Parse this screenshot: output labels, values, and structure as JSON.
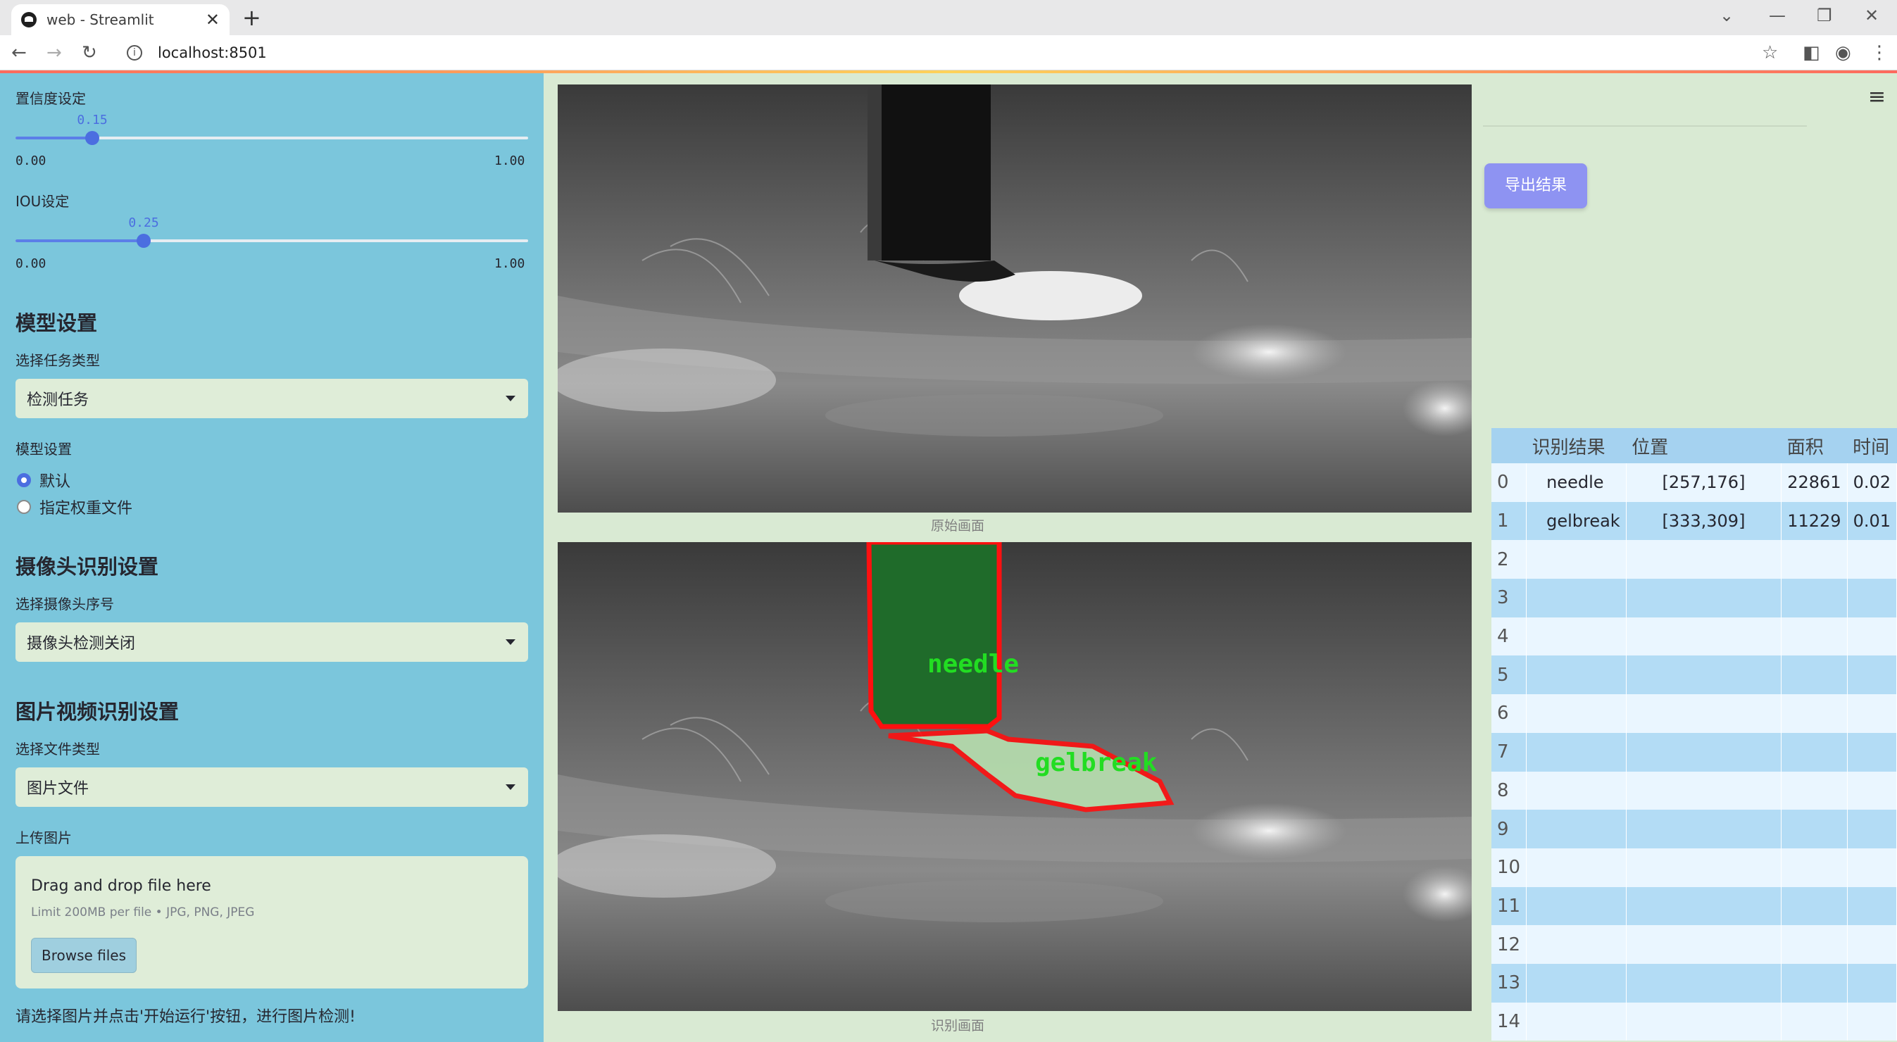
{
  "browser": {
    "tab_title": "web - Streamlit",
    "new_tab": "+",
    "url": "localhost:8501"
  },
  "sidebar": {
    "confidence": {
      "label": "置信度设定",
      "value": "0.15",
      "min": "0.00",
      "max": "1.00",
      "fraction": 0.15
    },
    "iou": {
      "label": "IOU设定",
      "value": "0.25",
      "min": "0.00",
      "max": "1.00",
      "fraction": 0.25
    },
    "model_section": {
      "heading": "模型设置",
      "task_label": "选择任务类型",
      "task_value": "检测任务",
      "model_label": "模型设置",
      "options": [
        "默认",
        "指定权重文件"
      ],
      "selected": "默认"
    },
    "camera_section": {
      "heading": "摄像头识别设置",
      "camera_label": "选择摄像头序号",
      "camera_value": "摄像头检测关闭"
    },
    "media_section": {
      "heading": "图片视频识别设置",
      "file_type_label": "选择文件类型",
      "file_type_value": "图片文件",
      "upload_label": "上传图片",
      "drop_text": "Drag and drop file here",
      "limit_text": "Limit 200MB per file • JPG, PNG, JPEG",
      "browse_label": "Browse files"
    },
    "footer_text": "请选择图片并点击'开始运行'按钮，进行图片检测!"
  },
  "main": {
    "original_caption": "原始画面",
    "detected_caption": "识别画面",
    "export_label": "导出结果",
    "detection_labels": [
      "needle",
      "gelbreak"
    ],
    "colors": {
      "mask_outline": "#ff0000",
      "label_text": "#22dd22"
    }
  },
  "results_table": {
    "headers": [
      "识别结果",
      "位置",
      "面积",
      "时间"
    ],
    "rows": [
      {
        "idx": "0",
        "name": "needle",
        "pos": "[257,176]",
        "area": "22861",
        "time": "0.02"
      },
      {
        "idx": "1",
        "name": "gelbreak",
        "pos": "[333,309]",
        "area": "11229",
        "time": "0.01"
      },
      {
        "idx": "2"
      },
      {
        "idx": "3"
      },
      {
        "idx": "4"
      },
      {
        "idx": "5"
      },
      {
        "idx": "6"
      },
      {
        "idx": "7"
      },
      {
        "idx": "8"
      },
      {
        "idx": "9"
      },
      {
        "idx": "10"
      },
      {
        "idx": "11"
      },
      {
        "idx": "12"
      },
      {
        "idx": "13"
      },
      {
        "idx": "14"
      }
    ]
  }
}
